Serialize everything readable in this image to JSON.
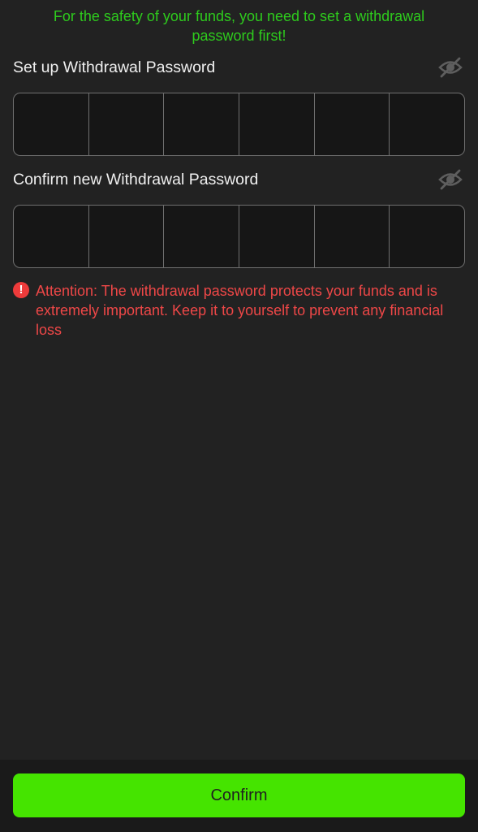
{
  "notice": {
    "text": "For the safety of your funds, you need to set a withdrawal password first!"
  },
  "set_password": {
    "label": "Set up Withdrawal Password",
    "toggle_icon": "eye-off-icon",
    "digits": [
      "",
      "",
      "",
      "",
      "",
      ""
    ]
  },
  "confirm_password": {
    "label": "Confirm new Withdrawal Password",
    "toggle_icon": "eye-off-icon",
    "digits": [
      "",
      "",
      "",
      "",
      "",
      ""
    ]
  },
  "warning": {
    "icon": "exclamation-icon",
    "icon_glyph": "!",
    "text": "Attention: The withdrawal password protects your funds and is extremely important. Keep it to yourself to prevent any financial loss"
  },
  "confirm_button": {
    "label": "Confirm"
  },
  "colors": {
    "background": "#222222",
    "notice": "#2ecb1d",
    "warning": "#ee4747",
    "button": "#45e400"
  }
}
